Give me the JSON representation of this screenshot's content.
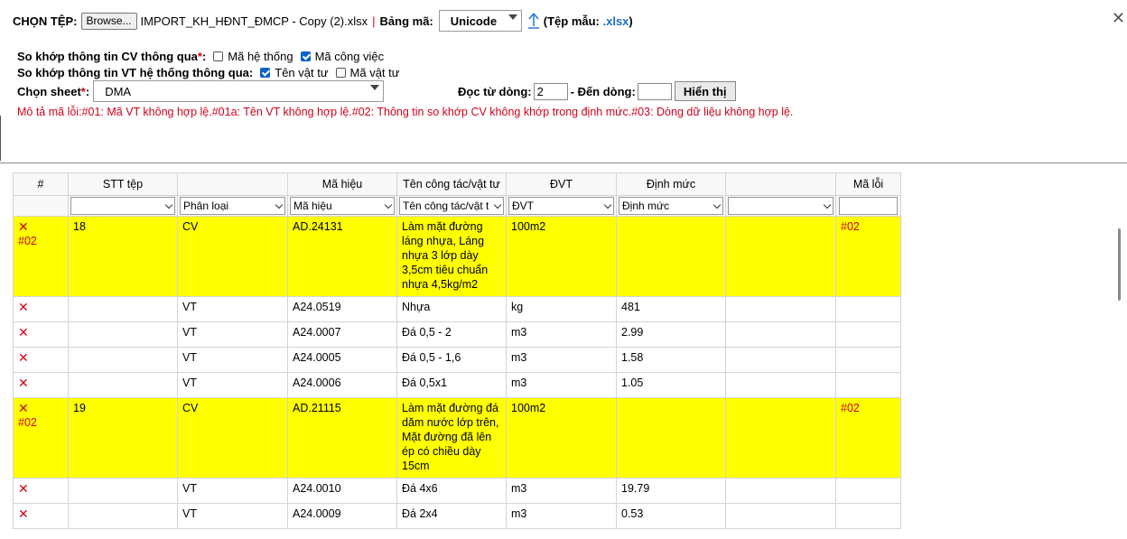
{
  "file": {
    "label": "CHỌN TỆP:",
    "browse": "Browse...",
    "filename": "IMPORT_KH_HĐNT_ĐMCP - Copy (2).xlsx",
    "separator": "|",
    "encoding_label": "Bảng mã:",
    "encoding_value": "Unicode",
    "template_prefix": "(Tệp mẫu: ",
    "template_ext": ".xlsx",
    "template_suffix": ")"
  },
  "match_cv": {
    "label": "So khớp thông tin CV thông qua",
    "req": "*",
    "colon": ":",
    "opt1": "Mã hệ thống",
    "opt2": "Mã công việc"
  },
  "match_vt": {
    "label": "So khớp thông tin VT hệ thống thông qua:",
    "opt1": "Tên vật tư",
    "opt2": "Mã vật tư"
  },
  "sheet": {
    "label": "Chọn sheet",
    "req": "*",
    "colon": ":",
    "value": "DMA"
  },
  "range": {
    "from_label": "Đọc từ dòng:",
    "from_value": "2",
    "to_label": "- Đến dòng:",
    "to_value": "",
    "show_button": "Hiển thị"
  },
  "error_desc": "Mô tả mã lỗi:#01: Mã VT không hợp lệ.#01a: Tên VT không hợp lệ.#02: Thông tin so khớp CV không khớp trong định mức.#03: Dòng dữ liệu không hợp lệ.",
  "close_glyph": "✕",
  "table": {
    "headers": [
      "#",
      "STT tệp",
      "",
      "Mã hiệu",
      "Tên công tác/vật tư",
      "ĐVT",
      "Định mức",
      "",
      "Mã lỗi"
    ],
    "filters": [
      "",
      "Phân loại",
      "Mã hiệu",
      "Tên công tác/vật tư",
      "ĐVT",
      "Định mức",
      ""
    ],
    "x_glyph": "✕",
    "rows": [
      {
        "err_mark": "#02",
        "stt": "18",
        "type": "CV",
        "code": "AD.24131",
        "name": "Làm mặt đường láng nhựa, Láng nhựa 3 lớp dày 3,5cm tiêu chuẩn nhựa 4,5kg/m2",
        "unit": "100m2",
        "norm": "",
        "err": "#02"
      },
      {
        "err_mark": "",
        "stt": "",
        "type": "VT",
        "code": "A24.0519",
        "name": "Nhựa",
        "unit": "kg",
        "norm": "481",
        "err": ""
      },
      {
        "err_mark": "",
        "stt": "",
        "type": "VT",
        "code": "A24.0007",
        "name": "Đá 0,5 - 2",
        "unit": "m3",
        "norm": "2.99",
        "err": ""
      },
      {
        "err_mark": "",
        "stt": "",
        "type": "VT",
        "code": "A24.0005",
        "name": "Đá 0,5 - 1,6",
        "unit": "m3",
        "norm": "1.58",
        "err": ""
      },
      {
        "err_mark": "",
        "stt": "",
        "type": "VT",
        "code": "A24.0006",
        "name": "Đá 0,5x1",
        "unit": "m3",
        "norm": "1.05",
        "err": ""
      },
      {
        "err_mark": "#02",
        "stt": "19",
        "type": "CV",
        "code": "AD.21115",
        "name": "Làm mặt đường đá dăm nước lớp trên, Mặt đường đã lên ép có chiều dày 15cm",
        "unit": "100m2",
        "norm": "",
        "err": "#02"
      },
      {
        "err_mark": "",
        "stt": "",
        "type": "VT",
        "code": "A24.0010",
        "name": "Đá 4x6",
        "unit": "m3",
        "norm": "19.79",
        "err": ""
      },
      {
        "err_mark": "",
        "stt": "",
        "type": "VT",
        "code": "A24.0009",
        "name": "Đá 2x4",
        "unit": "m3",
        "norm": "0.53",
        "err": ""
      }
    ]
  }
}
